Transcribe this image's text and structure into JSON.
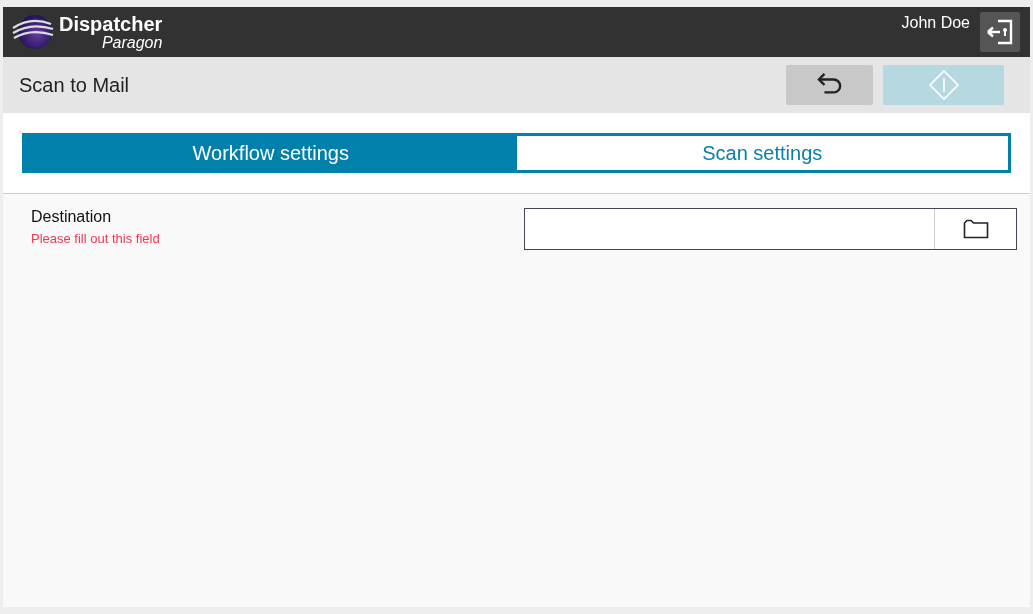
{
  "header": {
    "brand": "Dispatcher",
    "product": "Paragon",
    "user": "John Doe"
  },
  "toolbar": {
    "title": "Scan to Mail",
    "start_disabled": true
  },
  "tabs": [
    {
      "label": "Workflow settings",
      "selected": true
    },
    {
      "label": "Scan settings",
      "selected": false
    }
  ],
  "fields": [
    {
      "label": "Destination",
      "error": "Please fill out this field"
    }
  ]
}
